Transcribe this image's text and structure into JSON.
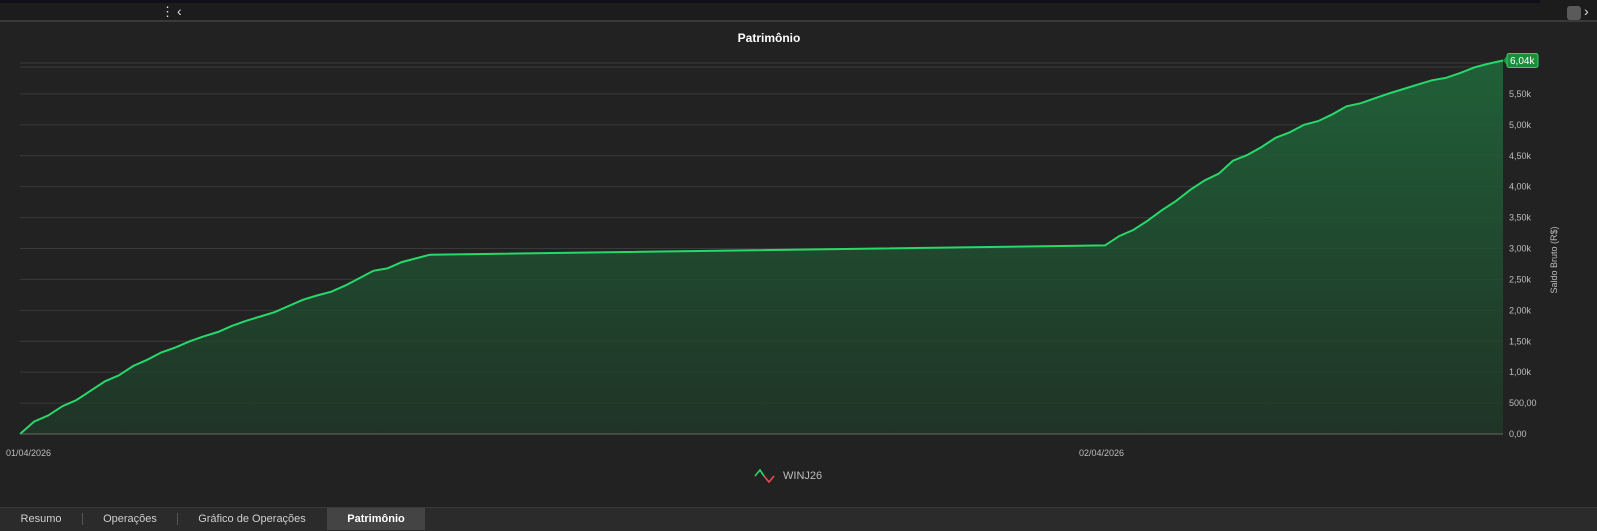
{
  "window": {
    "menu_icon": "vertical-dots-icon",
    "collapse_icon": "chevron-left-icon",
    "expand_icon": "chevron-right-icon"
  },
  "chart_data": {
    "type": "area",
    "title": "Patrimônio",
    "ylabel": "Saldo Bruto (R$)",
    "xlabel": "",
    "x_ticks": [
      "01/04/2026",
      "02/04/2026"
    ],
    "y_ticks": [
      "0,00",
      "500,00",
      "1,00k",
      "1,50k",
      "2,00k",
      "2,50k",
      "3,00k",
      "3,50k",
      "4,00k",
      "4,50k",
      "5,00k",
      "5,50k"
    ],
    "ylim": [
      0,
      6000
    ],
    "last_value_label": "6,04k",
    "grid": true,
    "colors": {
      "line": "#27d86b",
      "fill": "#1f6b3c",
      "label_bg": "#1e8a3c"
    },
    "legend": {
      "position": "bottom-center"
    },
    "series": [
      {
        "name": "WINJ26",
        "values": [
          0,
          200,
          300,
          450,
          550,
          700,
          850,
          950,
          1100,
          1200,
          1320,
          1400,
          1500,
          1580,
          1650,
          1750,
          1830,
          1900,
          1970,
          2070,
          2170,
          2240,
          2300,
          2400,
          2520,
          2640,
          2680,
          2780,
          2840,
          2900,
          3050,
          3200,
          3300,
          3450,
          3620,
          3770,
          3950,
          4100,
          4210,
          4420,
          4510,
          4640,
          4790,
          4880,
          5000,
          5060,
          5170,
          5300,
          5350,
          5430,
          5510,
          5580,
          5650,
          5720,
          5760,
          5840,
          5930,
          5990,
          6040
        ]
      }
    ]
  },
  "tabs": [
    {
      "label": "Resumo",
      "active": false
    },
    {
      "label": "Operações",
      "active": false
    },
    {
      "label": "Gráfico de Operações",
      "active": false
    },
    {
      "label": "Patrimônio",
      "active": true
    }
  ]
}
